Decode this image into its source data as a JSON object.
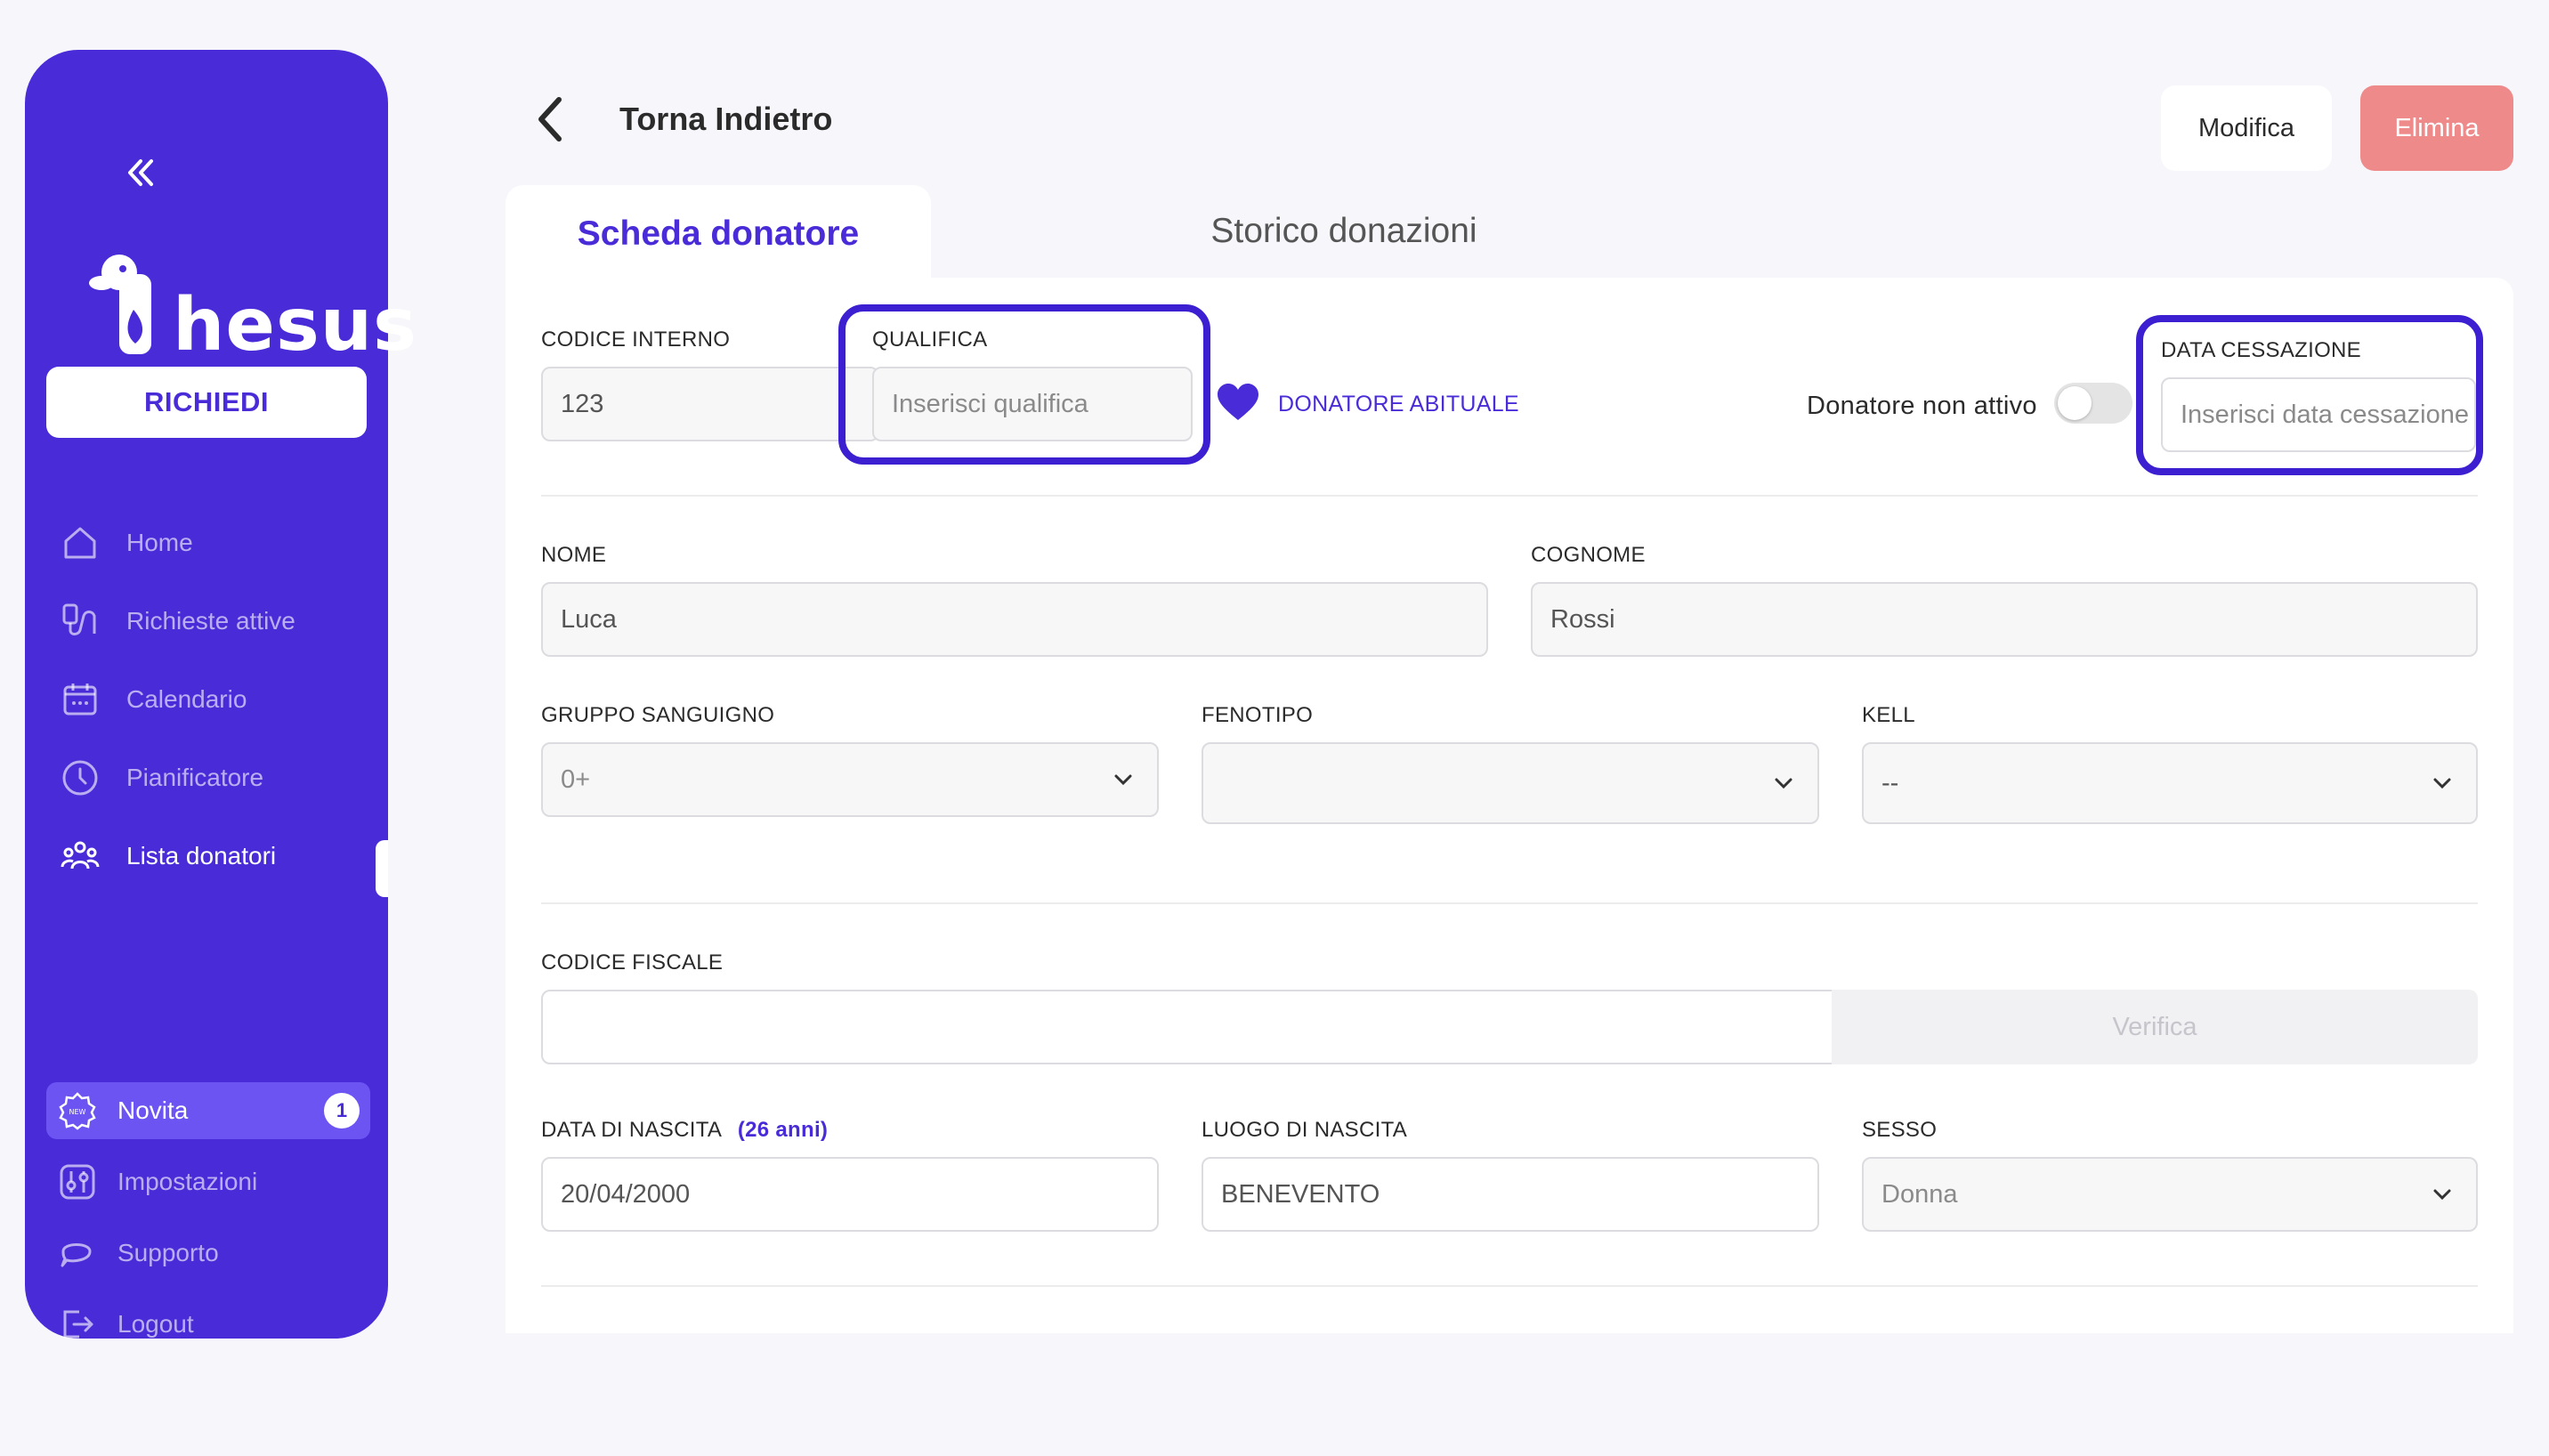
{
  "sidebar": {
    "brand": "hesus",
    "request_button": "RICHIEDI",
    "nav": [
      {
        "label": "Home",
        "icon": "home-icon"
      },
      {
        "label": "Richieste attive",
        "icon": "blood-bag-icon"
      },
      {
        "label": "Calendario",
        "icon": "calendar-icon"
      },
      {
        "label": "Pianificatore",
        "icon": "clock-icon"
      },
      {
        "label": "Lista donatori",
        "icon": "users-icon",
        "active": true
      }
    ],
    "bottom": [
      {
        "label": "Novita",
        "icon": "new-badge-icon",
        "badge": "1",
        "highlight": true
      },
      {
        "label": "Impostazioni",
        "icon": "settings-icon"
      },
      {
        "label": "Supporto",
        "icon": "chat-icon"
      },
      {
        "label": "Logout",
        "icon": "logout-icon"
      }
    ],
    "new_icon_text": "NEW"
  },
  "header": {
    "back_label": "Torna Indietro",
    "edit_button": "Modifica",
    "delete_button": "Elimina"
  },
  "tabs": [
    {
      "label": "Scheda donatore",
      "active": true
    },
    {
      "label": "Storico donazioni",
      "active": false
    }
  ],
  "form": {
    "codice_interno": {
      "label": "CODICE INTERNO",
      "value": "123"
    },
    "qualifica": {
      "label": "QUALIFICA",
      "placeholder": "Inserisci qualifica"
    },
    "abituale": {
      "label": "DONATORE ABITUALE"
    },
    "non_attivo": {
      "label": "Donatore non attivo"
    },
    "data_cessazione": {
      "label": "DATA CESSAZIONE",
      "placeholder": "Inserisci data cessazione"
    },
    "nome": {
      "label": "NOME",
      "value": "Luca"
    },
    "cognome": {
      "label": "COGNOME",
      "value": "Rossi"
    },
    "gruppo": {
      "label": "GRUPPO SANGUIGNO",
      "value": "0+"
    },
    "fenotipo": {
      "label": "FENOTIPO",
      "value": ""
    },
    "kell": {
      "label": "KELL",
      "value": "--"
    },
    "codice_fiscale": {
      "label": "CODICE FISCALE",
      "value": "",
      "verify_button": "Verifica"
    },
    "data_nascita": {
      "label": "DATA DI NASCITA",
      "age": "(26 anni)",
      "value": "20/04/2000"
    },
    "luogo_nascita": {
      "label": "LUOGO DI NASCITA",
      "value": "BENEVENTO"
    },
    "sesso": {
      "label": "SESSO",
      "value": "Donna"
    }
  },
  "colors": {
    "brand": "#4a2bd8",
    "danger": "#ee8a8a",
    "highlight_outline": "#3c1fd0"
  }
}
